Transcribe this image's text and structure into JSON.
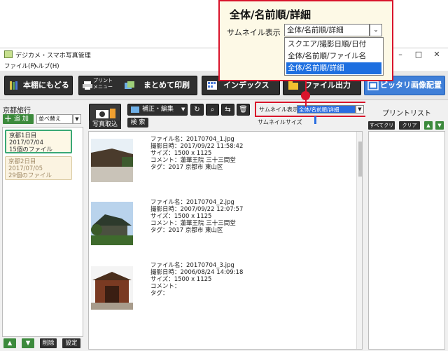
{
  "window": {
    "title": "デジカメ・スマホ写真管理",
    "controls": [
      "–",
      "□",
      "✕"
    ]
  },
  "menu": {
    "items": [
      "ファイル(F)",
      "ヘルプ(H)"
    ]
  },
  "toolbar": {
    "back_label": "本棚にもどる",
    "print_menu_label": "プリント\nメニュー",
    "batch_print_label": "まとめて印刷",
    "index_label": "インデックス",
    "file_output_label": "ファイル出力",
    "fit_layout_label": "ピッタリ画像配置"
  },
  "album_panel": {
    "title": "京都旅行",
    "add_label": "追 加",
    "sort_value": "並べ替え",
    "albums": [
      {
        "name": "京都1日目",
        "date": "2017/07/04",
        "count": "15個のファイル"
      },
      {
        "name": "京都2日目",
        "date": "2017/07/05",
        "count": "29個のファイル"
      }
    ],
    "delete_label": "削除",
    "settings_label": "設定"
  },
  "photo_panel": {
    "import_label": "写真取込",
    "edit_label": "補正・編集",
    "search_label": "検 索",
    "thumb_display_label": "サムネイル表示",
    "thumb_display_value": "全体/名前順/詳細",
    "thumb_size_label": "サムネイルサイズ",
    "photos": [
      {
        "filename": "ファイル名：20170704_1.jpg",
        "shot_date": "撮影日時：2017/09/22 11:58:42",
        "size": "サイズ：1500 x 1125",
        "comment": "コメント：蓮華王院 三十三間堂",
        "tag": "タグ：2017 京都市 東山区"
      },
      {
        "filename": "ファイル名：20170704_2.jpg",
        "shot_date": "撮影日時：2007/09/22 12:07:57",
        "size": "サイズ：1500 x 1125",
        "comment": "コメント：蓮華王院 三十三間堂",
        "tag": "タグ：2017 京都市 東山区"
      },
      {
        "filename": "ファイル名：20170704_3.jpg",
        "shot_date": "撮影日時：2006/08/24 14:09:18",
        "size": "サイズ：1500 x 1125",
        "comment": "コメント：",
        "tag": "タグ："
      }
    ]
  },
  "print_panel": {
    "title": "プリントリスト",
    "clear_all_label": "すべてクリア",
    "clear_label": "クリア"
  },
  "callout": {
    "title": "全体/名前順/詳細",
    "label": "サムネイル表示",
    "value": "全体/名前順/詳細",
    "options": [
      "スクエア/撮影日順/日付",
      "全体/名前順/ファイル名",
      "全体/名前順/詳細"
    ],
    "selected_index": 2
  },
  "colors": {
    "accent_red": "#d9142b",
    "selection_blue": "#1d6fe0",
    "toolbar_dark": "#2f2f2f",
    "album_selected_border": "#3aa875"
  }
}
